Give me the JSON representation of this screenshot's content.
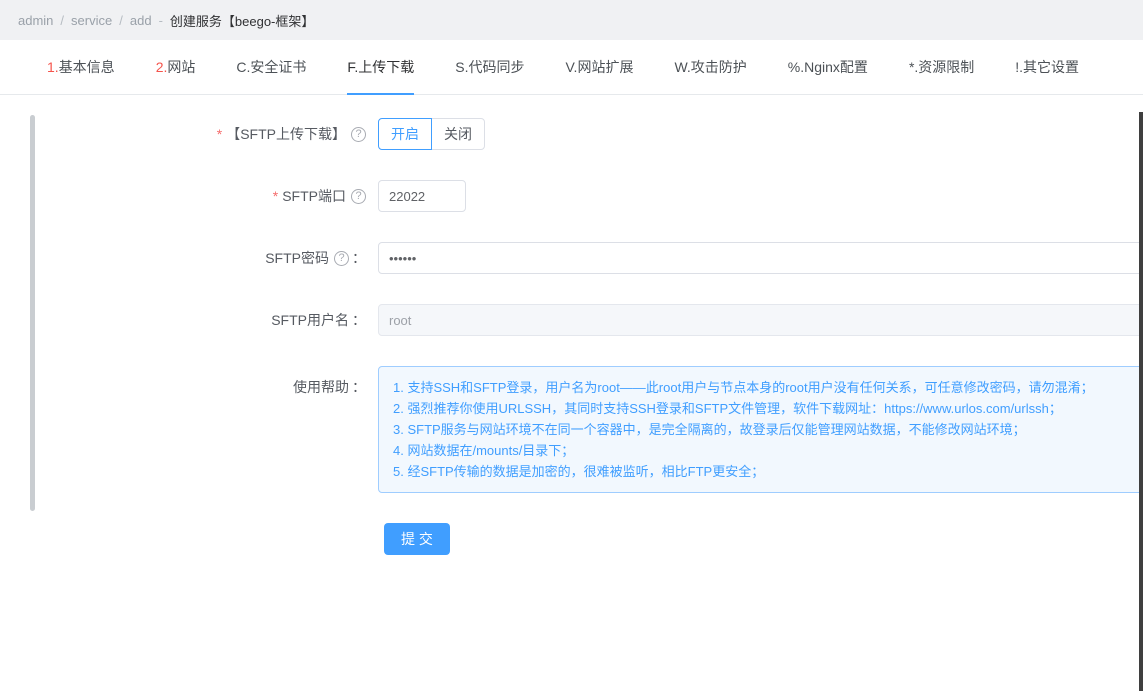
{
  "breadcrumb": {
    "items": [
      "admin",
      "service",
      "add"
    ],
    "separator": "/",
    "dash": "-",
    "title": "创建服务【beego-框架】"
  },
  "tabs": {
    "active_index": 3,
    "items": [
      {
        "prefix": "1.",
        "text": "基本信息"
      },
      {
        "prefix": "2.",
        "text": "网站"
      },
      {
        "prefix": "",
        "text": "C.安全证书"
      },
      {
        "prefix": "",
        "text": "F.上传下载"
      },
      {
        "prefix": "",
        "text": "S.代码同步"
      },
      {
        "prefix": "",
        "text": "V.网站扩展"
      },
      {
        "prefix": "",
        "text": "W.攻击防护"
      },
      {
        "prefix": "",
        "text": "%.Nginx配置"
      },
      {
        "prefix": "",
        "text": "*.资源限制"
      },
      {
        "prefix": "",
        "text": "!.其它设置"
      }
    ]
  },
  "form": {
    "required_mark": "*",
    "help_icon": "?",
    "sftp_toggle": {
      "label": "【SFTP上传下载】",
      "options": [
        {
          "label": "开启",
          "selected": true
        },
        {
          "label": "关闭",
          "selected": false
        }
      ],
      "selected": "开启"
    },
    "sftp_port": {
      "label": "SFTP端口",
      "value": "22022"
    },
    "sftp_password": {
      "label": "SFTP密码",
      "colon": "：",
      "value": "••••••"
    },
    "sftp_username": {
      "label": "SFTP用户名",
      "colon": "：",
      "value": "root",
      "disabled": true
    },
    "usage_help": {
      "label": "使用帮助",
      "colon": "：",
      "lines": [
        "1. 支持SSH和SFTP登录，用户名为root——此root用户与节点本身的root用户没有任何关系，可任意修改密码，请勿混淆；",
        "2. 强烈推荐你使用URLSSH，其同时支持SSH登录和SFTP文件管理，软件下载网址：https://www.urlos.com/urlssh；",
        "3. SFTP服务与网站环境不在同一个容器中，是完全隔离的，故登录后仅能管理网站数据，不能修改网站环境；",
        "4. 网站数据在/mounts/目录下；",
        "5. 经SFTP传输的数据是加密的，很难被监听，相比FTP更安全；"
      ]
    },
    "submit_label": "提 交"
  },
  "colors": {
    "accent": "#409eff",
    "required": "#f56c6c",
    "help_text": "#409eff",
    "help_border": "#9fcdff",
    "help_bg": "#f2f8fe"
  }
}
